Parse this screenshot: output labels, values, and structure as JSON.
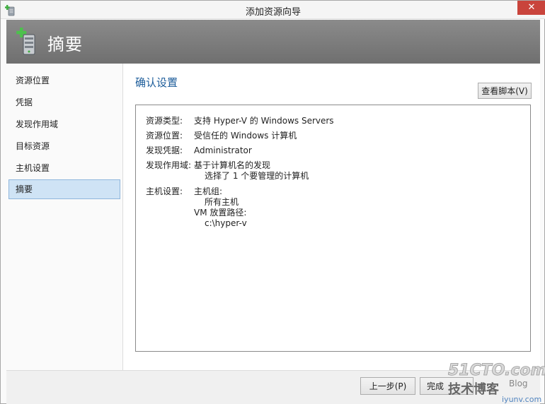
{
  "window": {
    "title": "添加资源向导",
    "close_label": "✕"
  },
  "header": {
    "title": "摘要"
  },
  "sidebar": {
    "items": [
      {
        "label": "资源位置"
      },
      {
        "label": "凭据"
      },
      {
        "label": "发现作用域"
      },
      {
        "label": "目标资源"
      },
      {
        "label": "主机设置"
      },
      {
        "label": "摘要",
        "active": true
      }
    ]
  },
  "main": {
    "section_title": "确认设置",
    "view_script_label": "查看脚本(V)",
    "summary": {
      "resource_type": {
        "key": "资源类型:",
        "value": "支持 Hyper-V 的 Windows Servers"
      },
      "resource_location": {
        "key": "资源位置:",
        "value": "受信任的 Windows 计算机"
      },
      "discovery_credential": {
        "key": "发现凭据:",
        "value": "Administrator"
      },
      "discovery_scope": {
        "key": "发现作用域:",
        "value": "基于计算机名的发现",
        "detail": "选择了 1 个要管理的计算机"
      },
      "host_settings": {
        "key": "主机设置:",
        "group_label": "主机组:",
        "group_value": "所有主机",
        "vm_path_label": "VM 放置路径:",
        "vm_path_value": "c:\\hyper-v"
      }
    }
  },
  "footer": {
    "prev_label": "上一步(P)",
    "finish_label": "完成"
  },
  "watermark": {
    "line1": "51CTO.com",
    "line2": "技术博客",
    "line3": "Blog",
    "line4": "iyunv.com"
  },
  "colors": {
    "header_gray": "#7a7a7a",
    "accent_blue": "#1c5c9a",
    "selected_bg": "#cfe3f5",
    "close_red": "#c9443c"
  }
}
